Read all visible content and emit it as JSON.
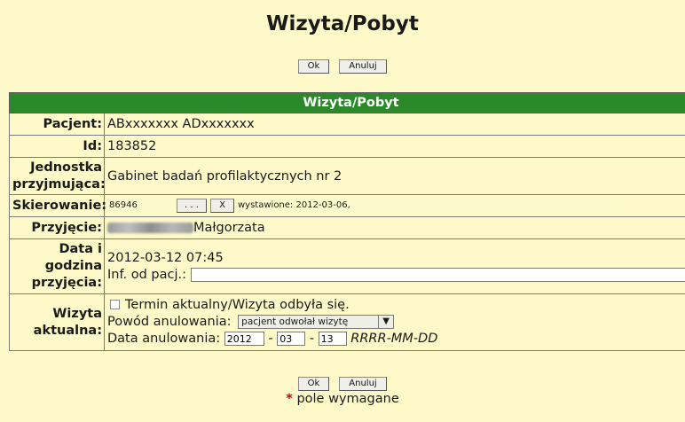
{
  "page": {
    "title": "Wizyta/Pobyt",
    "ok_label": "Ok",
    "cancel_label": "Anuluj"
  },
  "form": {
    "header": "Wizyta/Pobyt",
    "patient": {
      "label": "Pacjent:",
      "value": "ABxxxxxxx ADxxxxxxx"
    },
    "id": {
      "label": "Id:",
      "value": "183852"
    },
    "unit": {
      "label": "Jednostka przyjmująca:",
      "value": "Gabinet badań profilaktycznych nr 2"
    },
    "referral": {
      "label": "Skierowanie:",
      "number": "86946",
      "browse_label": ". . .",
      "clear_label": "X",
      "issued_text": "wystawione: 2012-03-06,"
    },
    "admission": {
      "label": "Przyjęcie:",
      "name": "Małgorzata"
    },
    "datetime": {
      "label": "Data i godzina przyjęcia:",
      "value": "2012-03-12 07:45",
      "patient_info_label": "Inf. od pacj.:",
      "patient_info_value": ""
    },
    "current_visit": {
      "label": "Wizyta aktualna:",
      "checkbox_label": "Termin aktualny/Wizyta odbyła się.",
      "checked": false,
      "reason_label": "Powód anulowania:",
      "reason_value": "pacjent odwołał wizytę",
      "cancel_date_label": "Data anulowania:",
      "year": "2012",
      "month": "03",
      "day": "13",
      "separator": "-",
      "format_hint": "RRRR-MM-DD"
    }
  },
  "footer": {
    "required_star": "*",
    "required_text": " pole wymagane"
  }
}
